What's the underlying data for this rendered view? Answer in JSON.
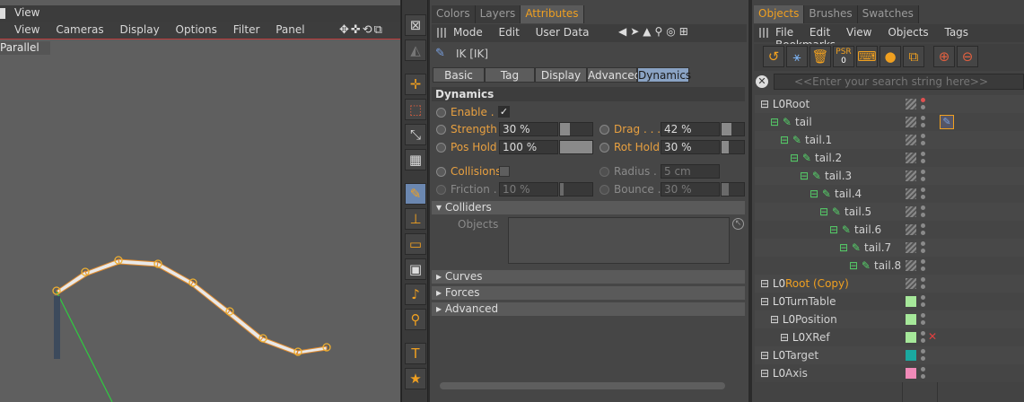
{
  "viewport": {
    "window_menu": "View",
    "menu": [
      "View",
      "Cameras",
      "Display",
      "Options",
      "Filter",
      "Panel"
    ],
    "camera_label": "Parallel"
  },
  "attributes": {
    "tabs": [
      "Colors",
      "Layers",
      "Attributes"
    ],
    "active_tab": "Attributes",
    "menu": [
      "Mode",
      "Edit",
      "User Data"
    ],
    "object_title": "IK [IK]",
    "subtabs": [
      "Basic",
      "Tag",
      "Display",
      "Advanced",
      "Dynamics"
    ],
    "active_subtab": "Dynamics",
    "section_title": "Dynamics",
    "enable_label": "Enable . .",
    "enable_check": "✓",
    "strength_label": "Strength",
    "strength_value": "30 %",
    "drag_label": "Drag . . . .",
    "drag_value": "42 %",
    "poshold_label": "Pos Hold",
    "poshold_value": "100 %",
    "rothold_label": "Rot Hold",
    "rothold_value": "30 %",
    "collisions_label": "Collisions",
    "radius_label": "Radius . .",
    "radius_value": "5 cm",
    "friction_label": "Friction . .",
    "friction_value": "10 %",
    "bounce_label": "Bounce . .",
    "bounce_value": "30 %",
    "colliders_label": "Colliders",
    "objects_label": "Objects",
    "curves_label": "Curves",
    "forces_label": "Forces",
    "advanced_label": "Advanced",
    "levels": {
      "strength": 0.3,
      "drag": 0.42,
      "poshold": 1.0,
      "rothold": 0.3,
      "friction": 0.1,
      "bounce": 0.3
    }
  },
  "objects": {
    "tabs": [
      "Objects",
      "Brushes",
      "Swatches"
    ],
    "active_tab": "Objects",
    "menu": [
      "File",
      "Edit",
      "View",
      "Objects",
      "Tags",
      "Bookmarks"
    ],
    "psr_label": "PSR",
    "psr_sub": "0",
    "search_placeholder": "<<Enter your search string here>>",
    "tree": [
      {
        "name": "Root",
        "highlight": false
      },
      {
        "name": "tail",
        "highlight": false
      },
      {
        "name": "tail.1",
        "highlight": false
      },
      {
        "name": "tail.2",
        "highlight": false
      },
      {
        "name": "tail.3",
        "highlight": false
      },
      {
        "name": "tail.4",
        "highlight": false
      },
      {
        "name": "tail.5",
        "highlight": false
      },
      {
        "name": "tail.6",
        "highlight": false
      },
      {
        "name": "tail.7",
        "highlight": false
      },
      {
        "name": "tail.8",
        "highlight": false
      },
      {
        "name": "Root (Copy)",
        "highlight": true
      },
      {
        "name": "TurnTable",
        "highlight": false
      },
      {
        "name": "Position",
        "highlight": false
      },
      {
        "name": "XRef",
        "highlight": false
      },
      {
        "name": "Target",
        "highlight": false
      },
      {
        "name": "Axis",
        "highlight": false
      }
    ],
    "colors": {
      "turntable": "#a6e89a",
      "target": "#1aa9a0",
      "axis": "#f08ab8",
      "highlight": "#f0a020"
    }
  }
}
